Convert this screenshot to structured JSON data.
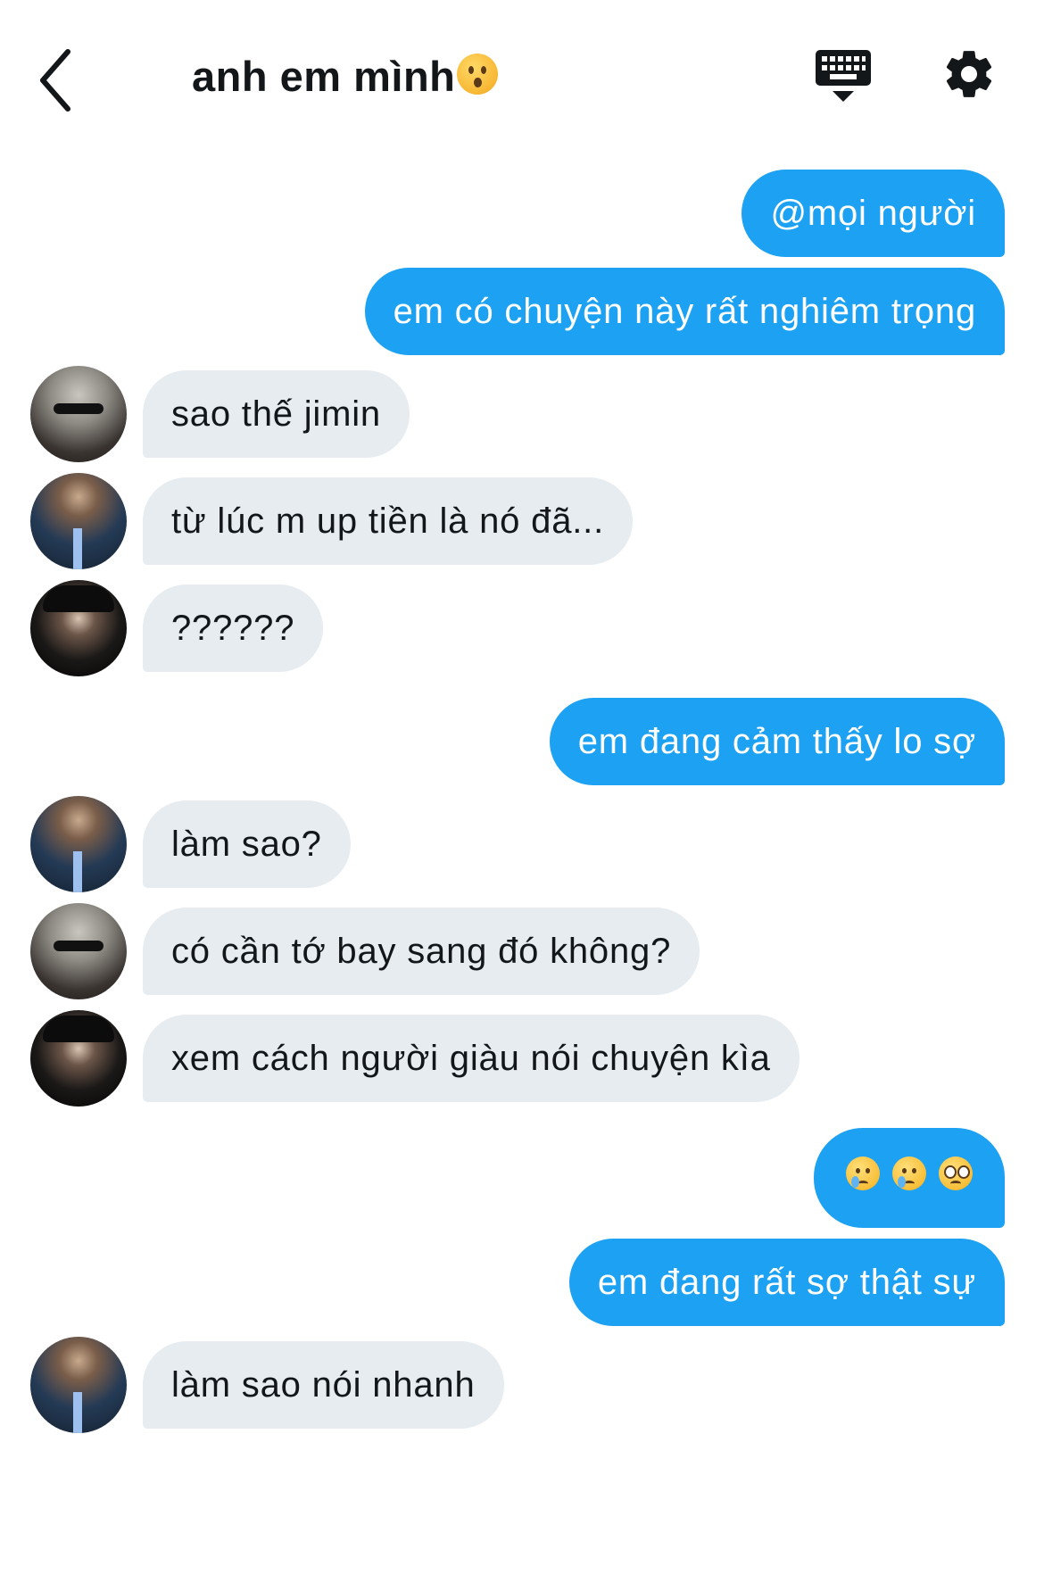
{
  "header": {
    "title": "anh em mình",
    "title_emoji": "hushed-face-emoji",
    "back_icon": "chevron-left-icon",
    "keyboard_icon": "keyboard-hide-icon",
    "settings_icon": "gear-icon"
  },
  "colors": {
    "outgoing_bubble": "#1da1f2",
    "incoming_bubble": "#e6ecf0",
    "background": "#ffffff"
  },
  "messages": [
    {
      "dir": "out",
      "text": "@mọi người"
    },
    {
      "dir": "out",
      "text": "em có chuyện này rất nghiêm trọng"
    },
    {
      "dir": "in",
      "avatar": "avatar-a",
      "text": "sao thế jimin"
    },
    {
      "dir": "in",
      "avatar": "avatar-b",
      "text": "từ lúc m up tiền là nó đã..."
    },
    {
      "dir": "in",
      "avatar": "avatar-c",
      "text": "??????"
    },
    {
      "dir": "out",
      "text": "em đang cảm thấy lo sợ"
    },
    {
      "dir": "in",
      "avatar": "avatar-b",
      "text": "làm sao?"
    },
    {
      "dir": "in",
      "avatar": "avatar-a",
      "text": "có cần tớ bay sang đó không?"
    },
    {
      "dir": "in",
      "avatar": "avatar-c",
      "text": "xem cách người giàu nói chuyện kìa"
    },
    {
      "dir": "out",
      "emojis": [
        "sad-but-relieved-emoji",
        "sad-but-relieved-emoji",
        "pleading-face-emoji"
      ]
    },
    {
      "dir": "out",
      "text": "em đang rất sợ thật sự"
    },
    {
      "dir": "in",
      "avatar": "avatar-b",
      "text": "làm sao nói nhanh"
    }
  ]
}
